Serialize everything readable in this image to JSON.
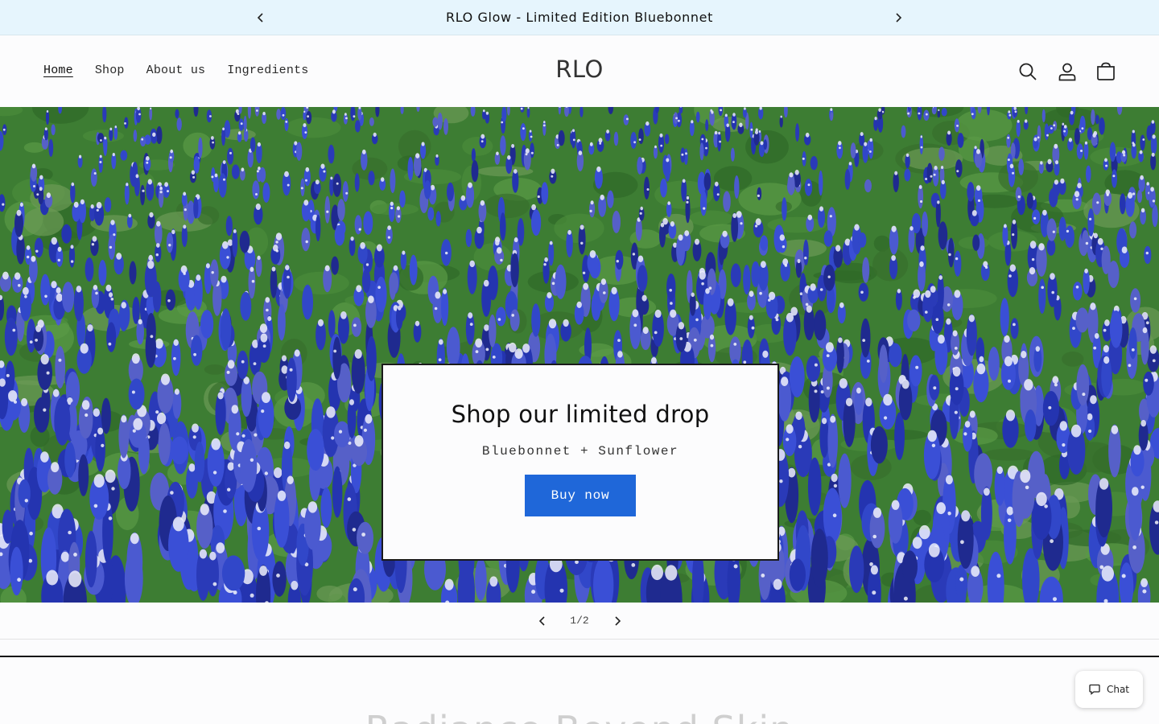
{
  "announcement": {
    "text": "RLO Glow - Limited Edition Bluebonnet",
    "prev_icon": "chevron-left-icon",
    "next_icon": "chevron-right-icon"
  },
  "header": {
    "nav": [
      {
        "label": "Home",
        "active": true
      },
      {
        "label": "Shop",
        "active": false
      },
      {
        "label": "About us",
        "active": false
      },
      {
        "label": "Ingredients",
        "active": false
      }
    ],
    "logo": "RLO",
    "icons": [
      "search-icon",
      "account-icon",
      "cart-icon"
    ]
  },
  "hero": {
    "image": "bluebonnet field",
    "title": "Shop our limited drop",
    "subtitle": "Bluebonnet + Sunflower",
    "button_label": "Buy now"
  },
  "slider": {
    "counter": "1/2"
  },
  "below": {
    "title": "Radiance Beyond Skin"
  },
  "chat": {
    "label": "Chat"
  },
  "colors": {
    "announcement_bg": "#e6f5fd",
    "button_bg": "#1f67d9",
    "flower_blue": "#2a3fb8",
    "foliage_green": "#3a7a2e"
  }
}
